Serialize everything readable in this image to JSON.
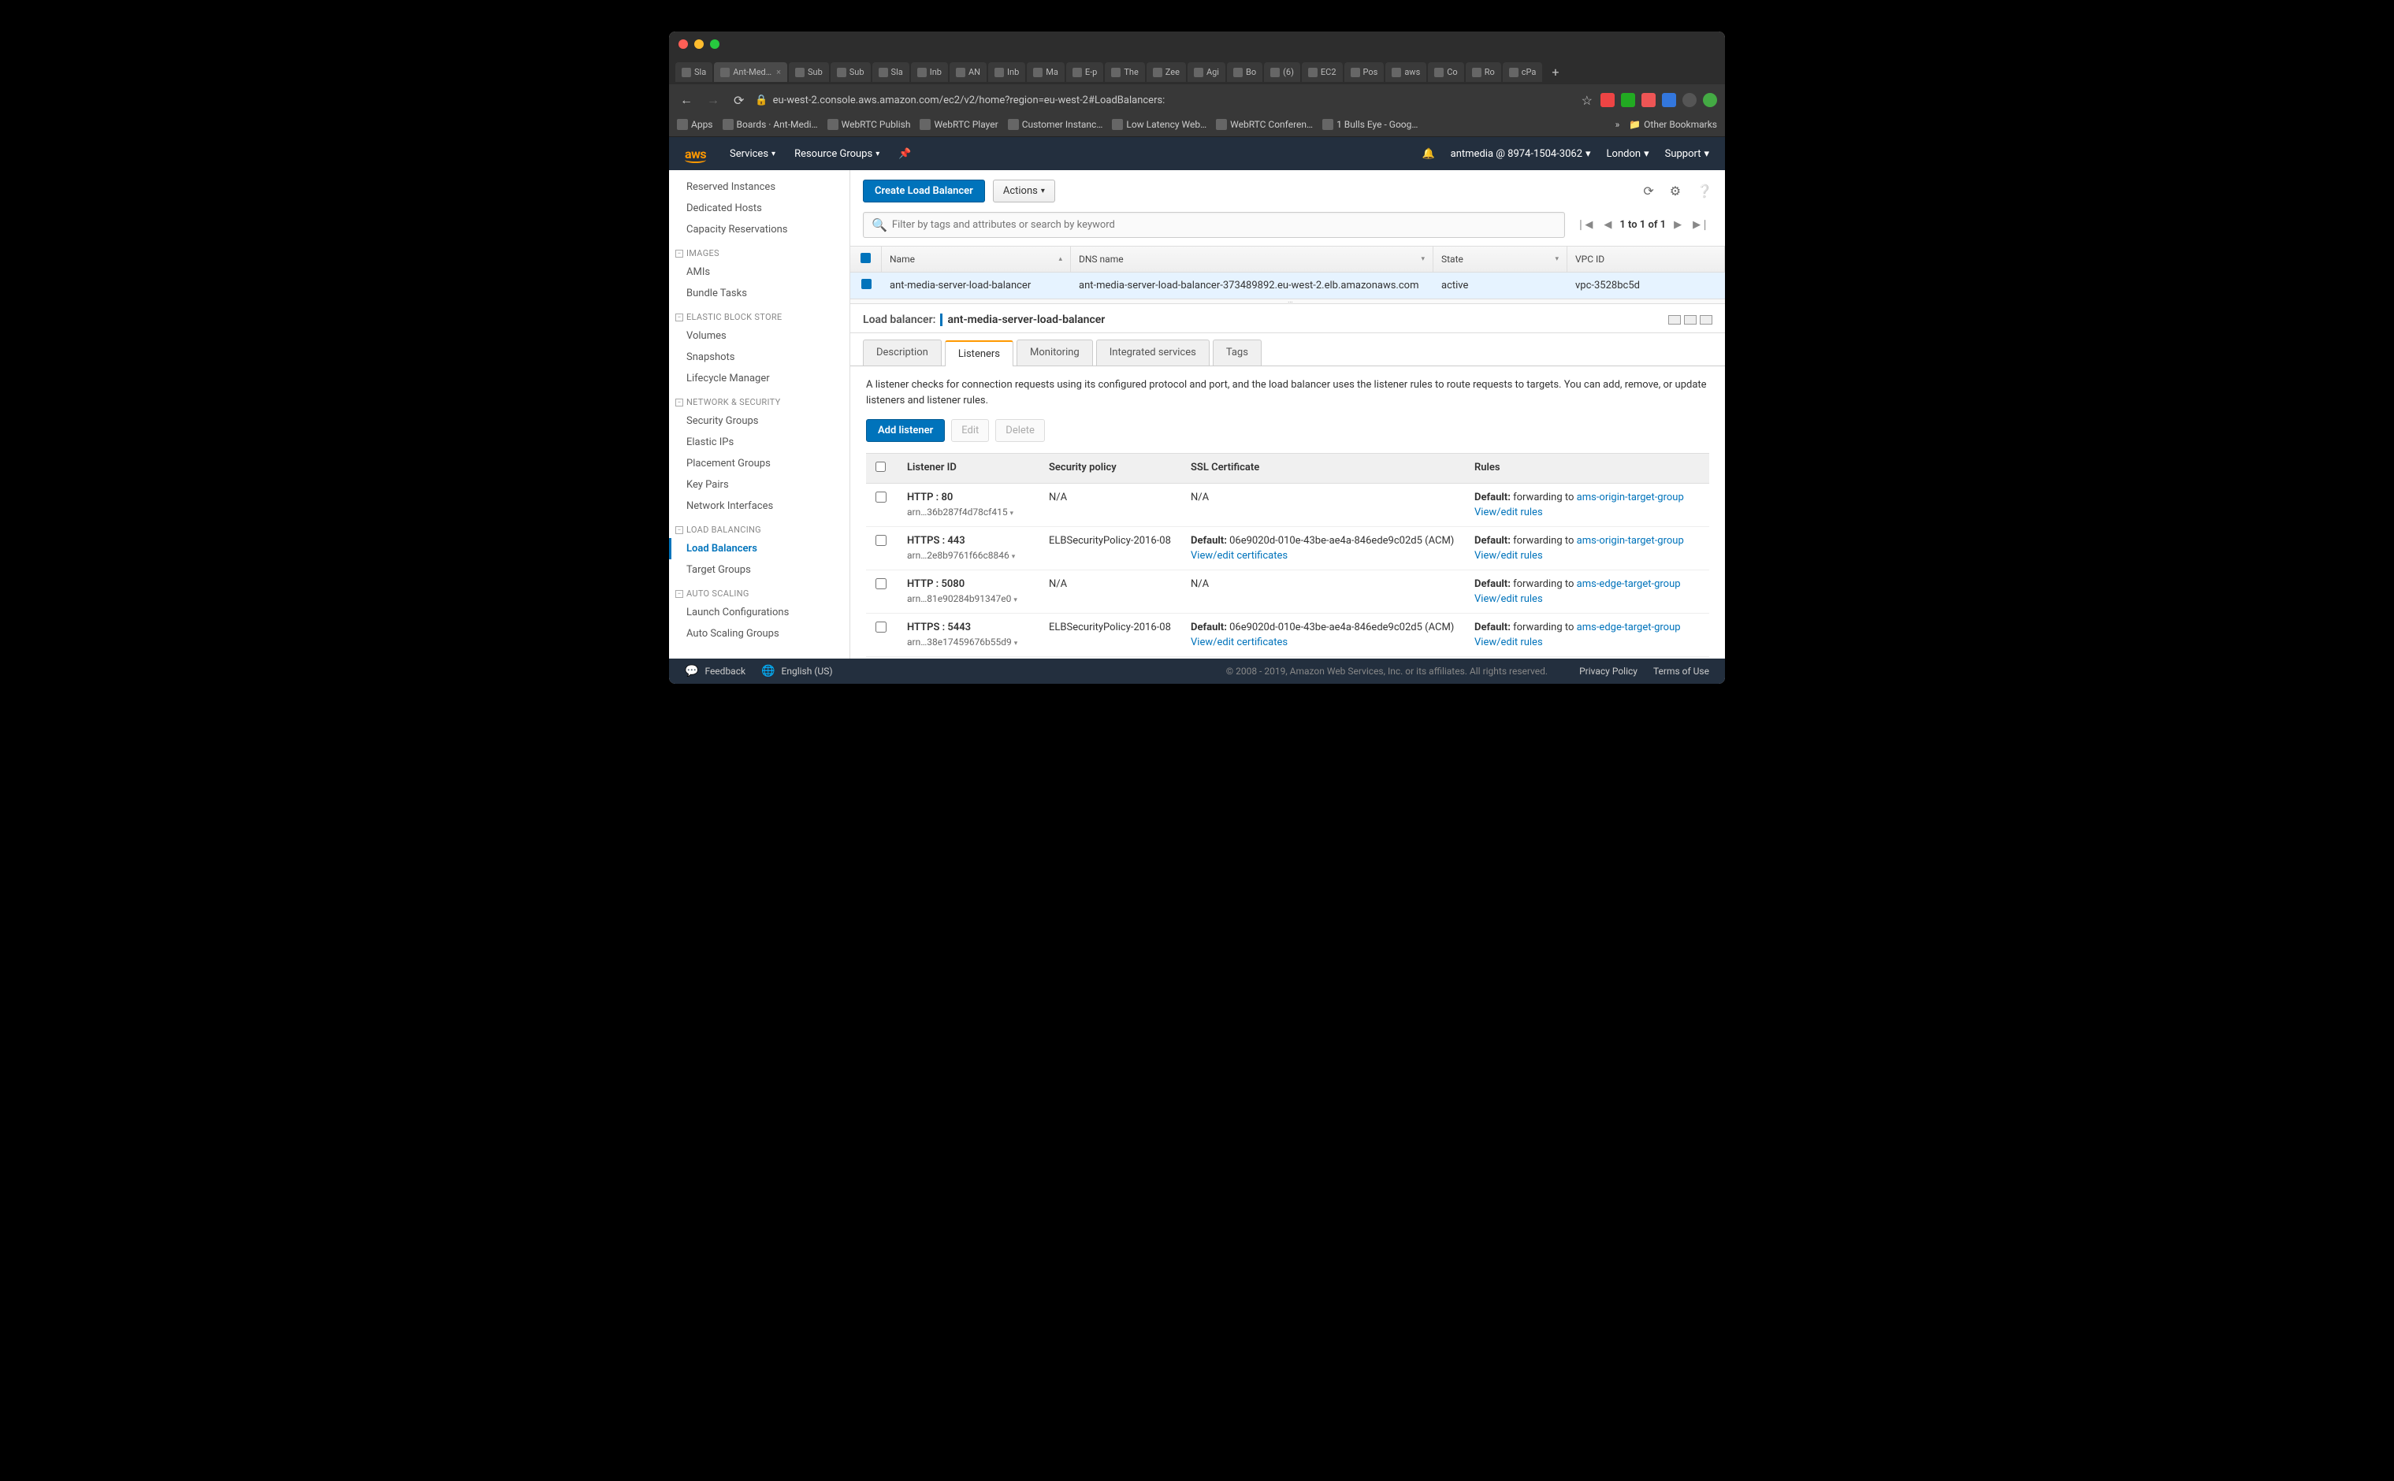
{
  "browser": {
    "tabs": [
      "Sla",
      "Ant-Med…",
      "Sub",
      "Sub",
      "Sla",
      "Inb",
      "AN",
      "Inb",
      "Ma",
      "E-p",
      "The",
      "Zee",
      "Agi",
      "Bo",
      "(6)",
      "EC2",
      "Pos",
      "aws",
      "Co",
      "Ro",
      "cPa"
    ],
    "url": "eu-west-2.console.aws.amazon.com/ec2/v2/home?region=eu-west-2#LoadBalancers:",
    "bookmarks": [
      "Apps",
      "Boards · Ant-Medi…",
      "WebRTC Publish",
      "WebRTC Player",
      "Customer Instanc…",
      "Low Latency Web…",
      "WebRTC Conferen…",
      "1 Bulls Eye - Goog…"
    ],
    "more_bookmarks_chevron": "»",
    "other_bookmarks": "Other Bookmarks"
  },
  "awsnav": {
    "logo": "aws",
    "services": "Services",
    "resource_groups": "Resource Groups",
    "account": "antmedia @ 8974-1504-3062",
    "region": "London",
    "support": "Support"
  },
  "sidebar": {
    "items_top": [
      "Reserved Instances",
      "Dedicated Hosts",
      "Capacity Reservations"
    ],
    "sec_images": "IMAGES",
    "items_images": [
      "AMIs",
      "Bundle Tasks"
    ],
    "sec_ebs": "ELASTIC BLOCK STORE",
    "items_ebs": [
      "Volumes",
      "Snapshots",
      "Lifecycle Manager"
    ],
    "sec_net": "NETWORK & SECURITY",
    "items_net": [
      "Security Groups",
      "Elastic IPs",
      "Placement Groups",
      "Key Pairs",
      "Network Interfaces"
    ],
    "sec_lb": "LOAD BALANCING",
    "items_lb": [
      "Load Balancers",
      "Target Groups"
    ],
    "sec_as": "AUTO SCALING",
    "items_as": [
      "Launch Configurations",
      "Auto Scaling Groups"
    ]
  },
  "toolbar": {
    "create": "Create Load Balancer",
    "actions": "Actions"
  },
  "search": {
    "placeholder": "Filter by tags and attributes or search by keyword"
  },
  "pager": {
    "text": "1 to 1 of 1"
  },
  "lbtable": {
    "cols": {
      "name": "Name",
      "dns": "DNS name",
      "state": "State",
      "vpc": "VPC ID"
    },
    "row": {
      "name": "ant-media-server-load-balancer",
      "dns": "ant-media-server-load-balancer-373489892.eu-west-2.elb.amazonaws.com",
      "state": "active",
      "vpc": "vpc-3528bc5d"
    }
  },
  "detail": {
    "label": "Load balancer:",
    "name": "ant-media-server-load-balancer",
    "tabs": [
      "Description",
      "Listeners",
      "Monitoring",
      "Integrated services",
      "Tags"
    ],
    "desc": "A listener checks for connection requests using its configured protocol and port, and the load balancer uses the listener rules to route requests to targets. You can add, remove, or update listeners and listener rules.",
    "add": "Add listener",
    "edit": "Edit",
    "delete": "Delete",
    "cols": {
      "id": "Listener ID",
      "sec": "Security policy",
      "ssl": "SSL Certificate",
      "rules": "Rules"
    },
    "default_lbl": "Default:",
    "fwd_to": "forwarding to",
    "view_rules": "View/edit rules",
    "view_certs": "View/edit certificates",
    "listeners": [
      {
        "proto": "HTTP : 80",
        "arn": "arn…36b287f4d78cf415",
        "sec": "N/A",
        "ssl_default": "",
        "ssl": "N/A",
        "ssl_link": "",
        "target": "ams-origin-target-group"
      },
      {
        "proto": "HTTPS : 443",
        "arn": "arn…2e8b9761f66c8846",
        "sec": "ELBSecurityPolicy-2016-08",
        "ssl_default": "Default:",
        "ssl": "06e9020d-010e-43be-ae4a-846ede9c02d5 (ACM)",
        "ssl_link": "View/edit certificates",
        "target": "ams-origin-target-group"
      },
      {
        "proto": "HTTP : 5080",
        "arn": "arn…81e90284b91347e0",
        "sec": "N/A",
        "ssl_default": "",
        "ssl": "N/A",
        "ssl_link": "",
        "target": "ams-edge-target-group"
      },
      {
        "proto": "HTTPS : 5443",
        "arn": "arn…38e17459676b55d9",
        "sec": "ELBSecurityPolicy-2016-08",
        "ssl_default": "Default:",
        "ssl": "06e9020d-010e-43be-ae4a-846ede9c02d5 (ACM)",
        "ssl_link": "View/edit certificates",
        "target": "ams-edge-target-group"
      }
    ]
  },
  "footer": {
    "feedback": "Feedback",
    "lang": "English (US)",
    "copy": "© 2008 - 2019, Amazon Web Services, Inc. or its affiliates. All rights reserved.",
    "privacy": "Privacy Policy",
    "terms": "Terms of Use"
  }
}
